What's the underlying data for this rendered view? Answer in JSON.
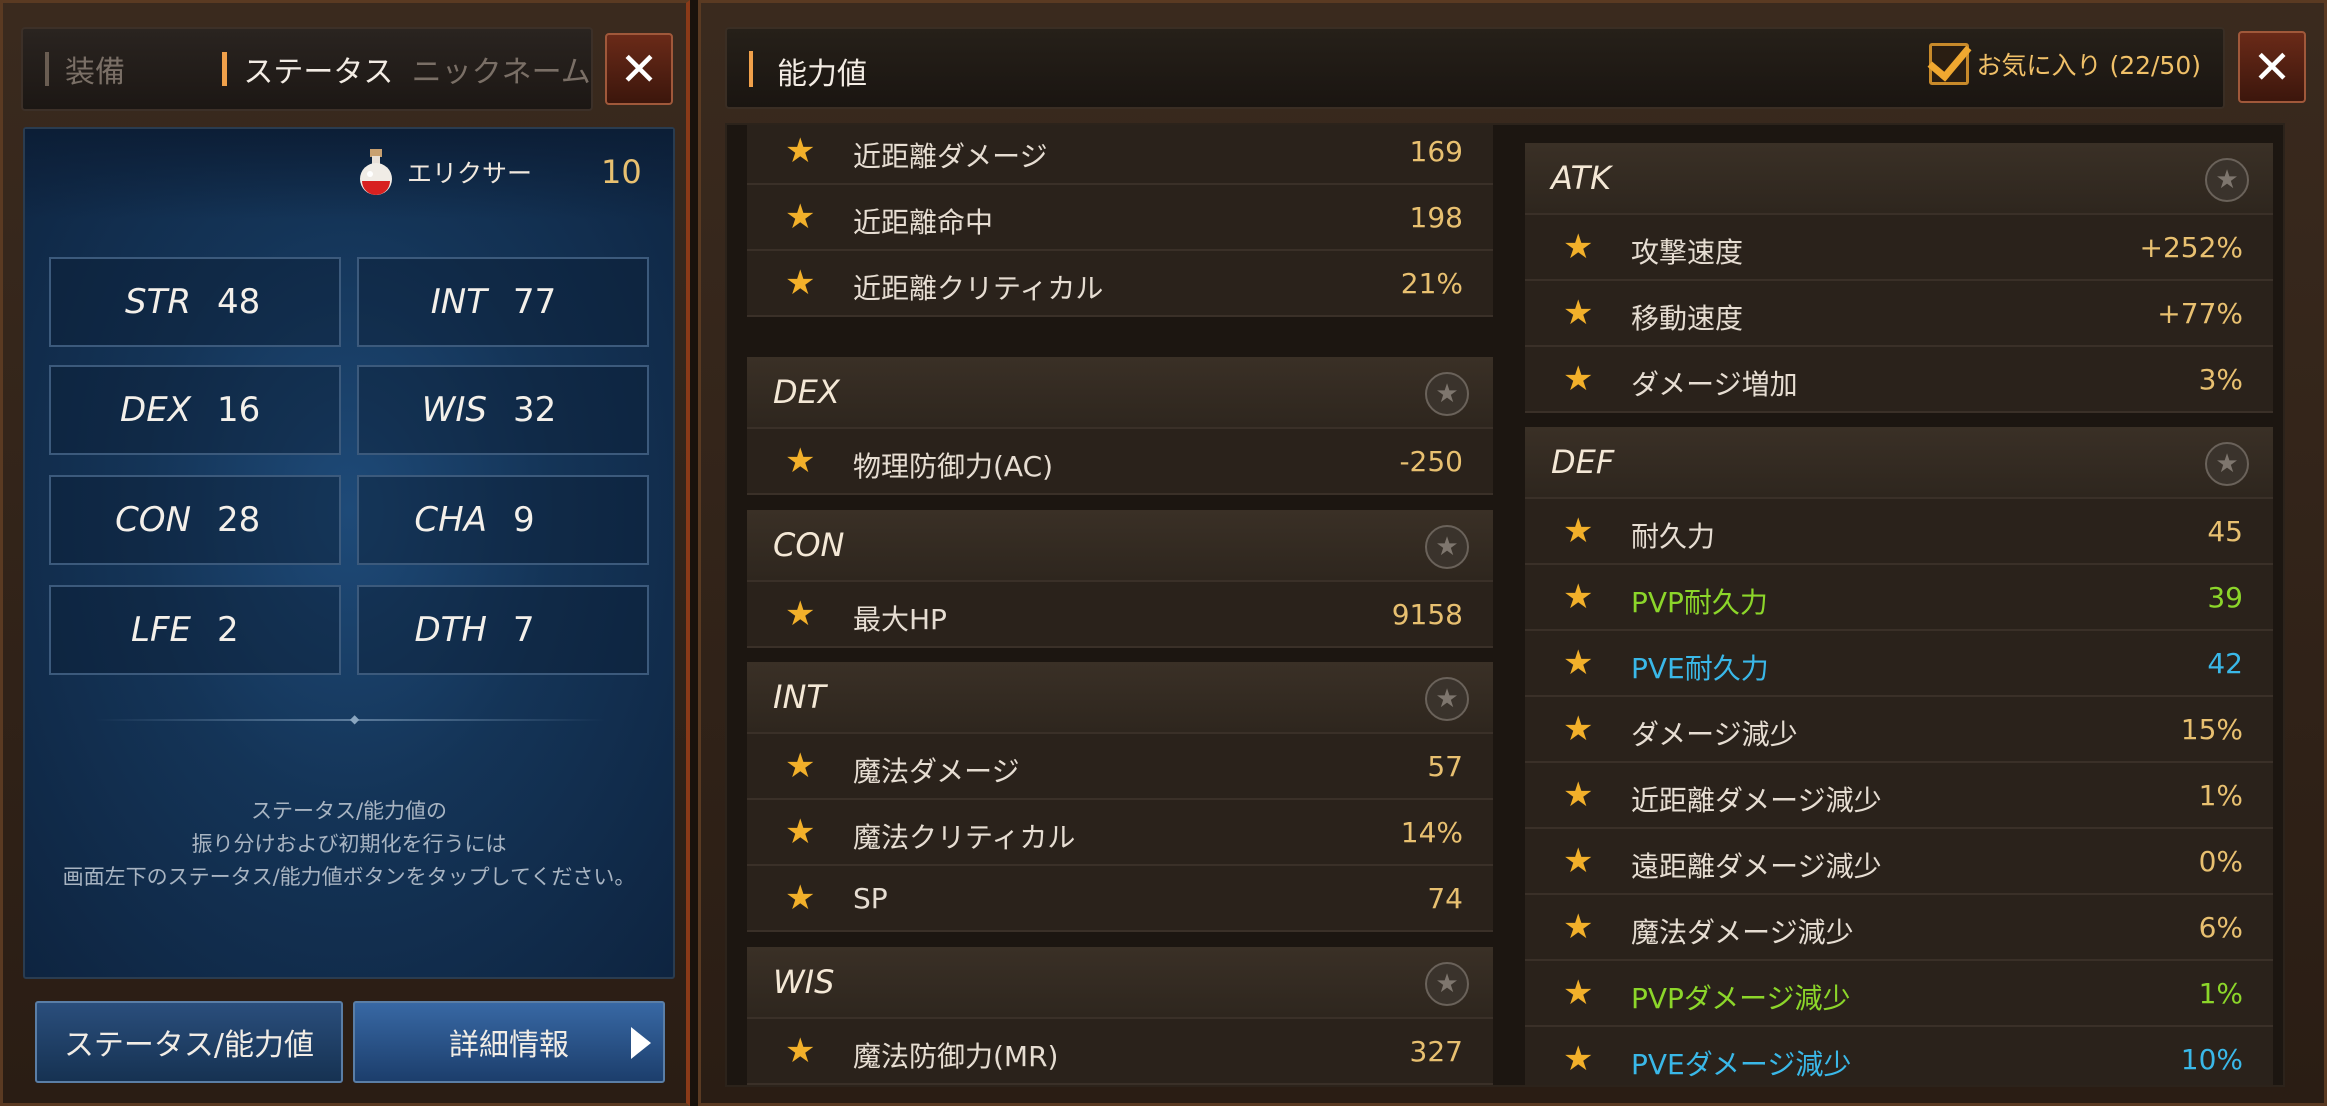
{
  "left": {
    "tabs": [
      {
        "label": "装備",
        "active": false
      },
      {
        "label": "ステータス",
        "active": true
      },
      {
        "label": "ニックネーム",
        "active": false
      }
    ],
    "close_label": "✕",
    "elixir": {
      "label": "エリクサー",
      "count": "10"
    },
    "stats": [
      {
        "name": "STR",
        "value": "48"
      },
      {
        "name": "INT",
        "value": "77"
      },
      {
        "name": "DEX",
        "value": "16"
      },
      {
        "name": "WIS",
        "value": "32"
      },
      {
        "name": "CON",
        "value": "28"
      },
      {
        "name": "CHA",
        "value": "9"
      },
      {
        "name": "LFE",
        "value": "2"
      },
      {
        "name": "DTH",
        "value": "7"
      }
    ],
    "help": [
      "ステータス/能力値の",
      "振り分けおよび初期化を行うには",
      "画面左下のステータス/能力値ボタンをタップしてください。"
    ],
    "buttons": {
      "status": "ステータス/能力値",
      "detail": "詳細情報"
    }
  },
  "right": {
    "title": "能力値",
    "favorite": {
      "label": "お気に入り (22/50)",
      "checked": true
    },
    "close_label": "✕",
    "left_column": [
      {
        "header": "",
        "rows": [
          {
            "name": "近距離ダメージ",
            "value": "169"
          },
          {
            "name": "近距離命中",
            "value": "198"
          },
          {
            "name": "近距離クリティカル",
            "value": "21%"
          }
        ]
      },
      {
        "header": "DEX",
        "rows": [
          {
            "name": "物理防御力(AC)",
            "value": "-250"
          }
        ]
      },
      {
        "header": "CON",
        "rows": [
          {
            "name": "最大HP",
            "value": "9158"
          }
        ]
      },
      {
        "header": "INT",
        "rows": [
          {
            "name": "魔法ダメージ",
            "value": "57"
          },
          {
            "name": "魔法クリティカル",
            "value": "14%"
          },
          {
            "name": "SP",
            "value": "74"
          }
        ]
      },
      {
        "header": "WIS",
        "rows": [
          {
            "name": "魔法防御力(MR)",
            "value": "327"
          }
        ]
      }
    ],
    "right_column": [
      {
        "header": "ATK",
        "rows": [
          {
            "name": "攻撃速度",
            "value": "+252%"
          },
          {
            "name": "移動速度",
            "value": "+77%"
          },
          {
            "name": "ダメージ増加",
            "value": "3%"
          }
        ]
      },
      {
        "header": "DEF",
        "rows": [
          {
            "name": "耐久力",
            "value": "45"
          },
          {
            "name": "PVP耐久力",
            "value": "39",
            "color": "green"
          },
          {
            "name": "PVE耐久力",
            "value": "42",
            "color": "blue"
          },
          {
            "name": "ダメージ減少",
            "value": "15%"
          },
          {
            "name": "近距離ダメージ減少",
            "value": "1%"
          },
          {
            "name": "遠距離ダメージ減少",
            "value": "0%"
          },
          {
            "name": "魔法ダメージ減少",
            "value": "6%"
          },
          {
            "name": "PVPダメージ減少",
            "value": "1%",
            "color": "green"
          },
          {
            "name": "PVEダメージ減少",
            "value": "10%",
            "color": "blue"
          }
        ]
      }
    ]
  },
  "colors": {
    "accent": "#f0a04a",
    "star": "#f2b02a",
    "value": "#e8c070",
    "green": "#8cd62a",
    "blue": "#3ab8e8"
  }
}
